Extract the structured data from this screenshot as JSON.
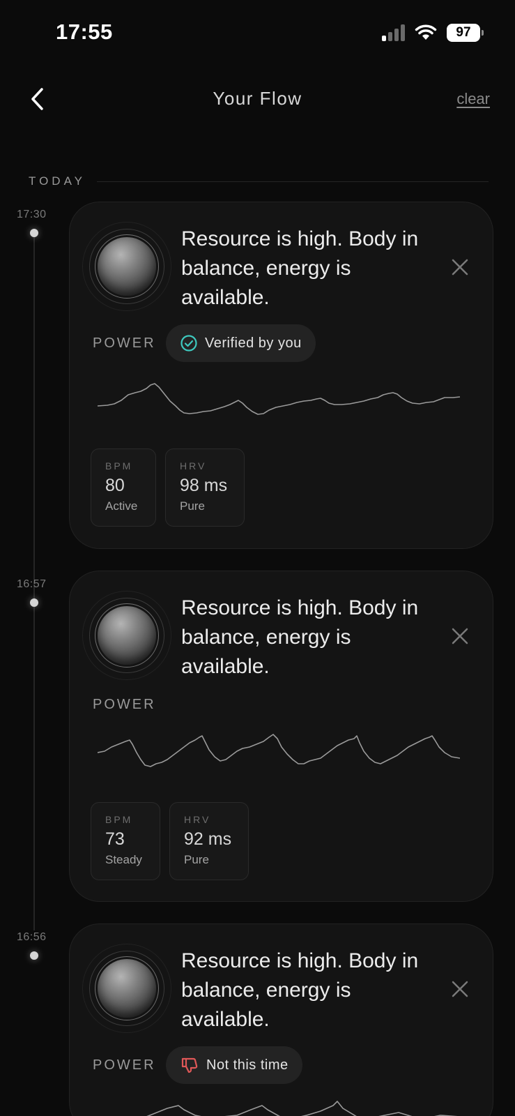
{
  "status_bar": {
    "time": "17:55",
    "battery": "97",
    "icons": [
      "cellular-signal-icon",
      "wifi-icon",
      "battery-icon"
    ]
  },
  "header": {
    "title": "Your Flow",
    "clear_label": "clear",
    "back_icon": "chevron-left-icon"
  },
  "section": {
    "label": "TODAY"
  },
  "entries": [
    {
      "time": "17:30",
      "message": "Resource is high. Body in balance, energy is available.",
      "state": "POWER",
      "feedback": {
        "label": "Verified by you",
        "icon": "check-circle-icon",
        "color": "#3ec9bf"
      },
      "metrics": [
        {
          "label": "BPM",
          "value": "80",
          "sub": "Active"
        },
        {
          "label": "HRV",
          "value": "98 ms",
          "sub": "Pure"
        }
      ]
    },
    {
      "time": "16:57",
      "message": "Resource is high. Body in balance, energy is available.",
      "state": "POWER",
      "metrics": [
        {
          "label": "BPM",
          "value": "73",
          "sub": "Steady"
        },
        {
          "label": "HRV",
          "value": "92 ms",
          "sub": "Pure"
        }
      ]
    },
    {
      "time": "16:56",
      "message": "Resource is high. Body in balance, energy is available.",
      "state": "POWER",
      "feedback": {
        "label": "Not this time",
        "icon": "thumbs-down-icon",
        "color": "#e05858"
      }
    }
  ]
}
